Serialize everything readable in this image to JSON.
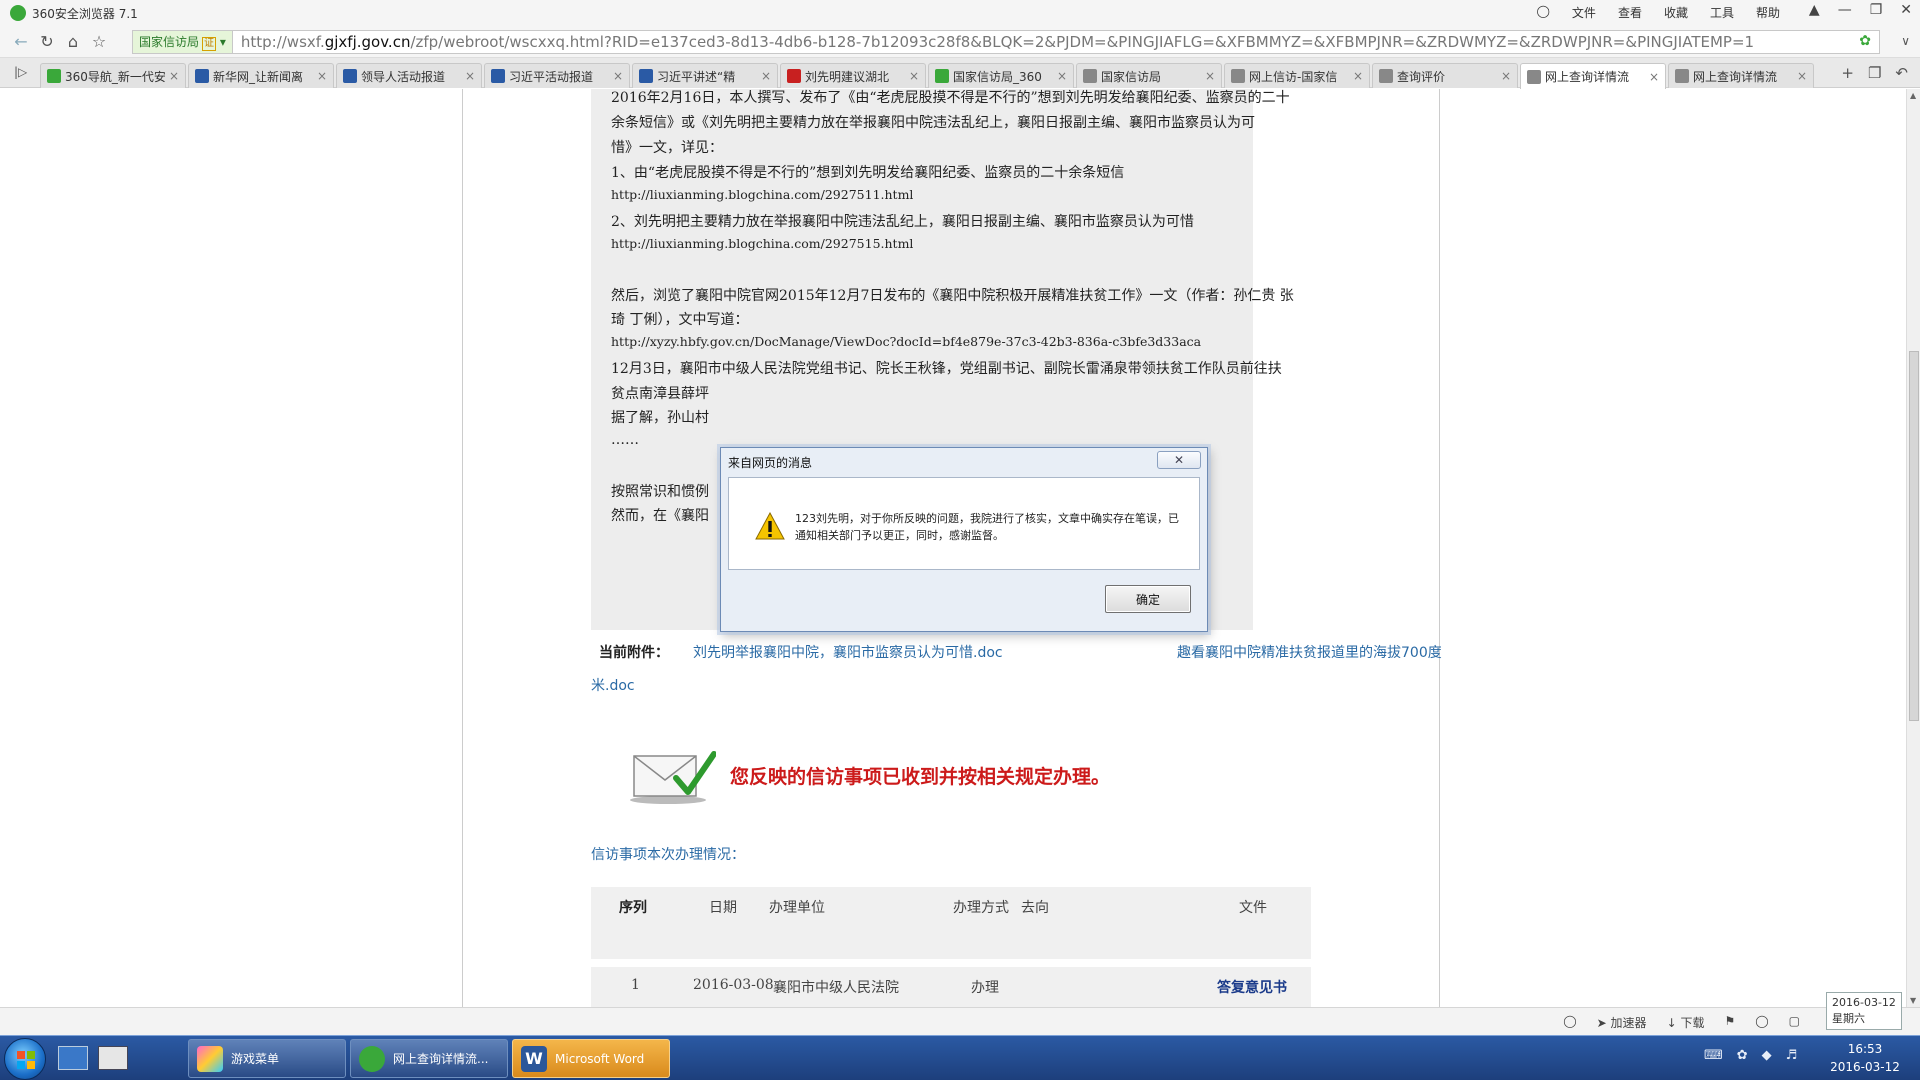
{
  "window": {
    "title": "360安全浏览器 7.1",
    "menus": [
      "文件",
      "查看",
      "收藏",
      "工具",
      "帮助"
    ]
  },
  "addressbar": {
    "site_id": "国家信访局",
    "cert_badge": "证",
    "url_prefix": "http://wsxf.",
    "url_domain": "gjxfj.gov.cn",
    "url_rest": "/zfp/webroot/wscxxq.html?RID=e137ced3-8d13-4db6-b128-7b12093c28f8&BLQK=2&PJDM=&PINGJIAFLG=&XFBMMYZ=&XFBMPJNR=&ZRDWMYZ=&ZRDWPJNR=&PINGJIATEMP=1"
  },
  "tabs": [
    {
      "label": "360导航_新一代安",
      "icon_color": "#3aa83a"
    },
    {
      "label": "新华网_让新闻离",
      "icon_color": "#2a5aa5"
    },
    {
      "label": "领导人活动报道",
      "icon_color": "#2a5aa5"
    },
    {
      "label": "习近平活动报道",
      "icon_color": "#2a5aa5"
    },
    {
      "label": "习近平讲述“精",
      "icon_color": "#2a5aa5"
    },
    {
      "label": "刘先明建议湖北",
      "icon_color": "#c82020"
    },
    {
      "label": "国家信访局_360",
      "icon_color": "#3aa83a"
    },
    {
      "label": "国家信访局",
      "icon_color": "#888888"
    },
    {
      "label": "网上信访-国家信",
      "icon_color": "#888888"
    },
    {
      "label": "查询评价",
      "icon_color": "#888888"
    },
    {
      "label": "网上查询详情流",
      "icon_color": "#888888"
    },
    {
      "label": "网上查询详情流",
      "icon_color": "#888888"
    }
  ],
  "letter": {
    "lines": [
      "2016年2月16日，本人撰写、发布了《由“老虎屁股摸不得是不行的”想到刘先明发给襄阳纪委、监察员的二十",
      "余条短信》或《刘先明把主要精力放在举报襄阳中院违法乱纪上，襄阳日报副主编、襄阳市监察员认为可",
      "惜》一文，详见：",
      "1、由“老虎屁股摸不得是不行的”想到刘先明发给襄阳纪委、监察员的二十余条短信",
      "http://liuxianming.blogchina.com/2927511.html",
      "2、刘先明把主要精力放在举报襄阳中院违法乱纪上，襄阳日报副主编、襄阳市监察员认为可惜",
      "http://liuxianming.blogchina.com/2927515.html",
      "然后，浏览了襄阳中院官网2015年12月7日发布的《襄阳中院积极开展精准扶贫工作》一文（作者：孙仁贵 张",
      "琦 丁俐），文中写道：",
      "http://xyzy.hbfy.gov.cn/DocManage/ViewDoc?docId=bf4e879e-37c3-42b3-836a-c3bfe3d33aca",
      "12月3日，襄阳市中级人民法院党组书记、院长王秋锋，党组副书记、副院长雷涌泉带领扶贫工作队员前往扶",
      "贫点南漳县薛坪",
      "据了解，孙山村",
      "……",
      "按照常识和惯例",
      "然而，在《襄阳"
    ]
  },
  "attachments": {
    "label": "当前附件：",
    "file1": "刘先明举报襄阳中院，襄阳市监察员认为可惜.doc",
    "file2_part1": "趣看襄阳中院精准扶贫报道里的海拔700度",
    "file2_part2": "米.doc"
  },
  "received_message": "您反映的信访事项已收到并按相关规定办理。",
  "status_section": {
    "title": "信访事项本次办理情况：",
    "headers": {
      "seq": "序列",
      "date": "日期",
      "unit": "办理单位",
      "method": "办理方式",
      "direction": "去向",
      "file": "文件"
    },
    "rows": [
      {
        "seq": "1",
        "date": "2016-03-08",
        "unit": "襄阳市中级人民法院",
        "method": "办理",
        "file": "答复意见书"
      }
    ]
  },
  "dialog": {
    "title": "来自网页的消息",
    "message": "123刘先明，对于你所反映的问题，我院进行了核实，文章中确实存在笔误，已通知相关部门予以更正，同时，感谢监督。",
    "ok_label": "确定"
  },
  "statusbar": {
    "items": [
      "加速器",
      "下载"
    ],
    "date_popup": {
      "date": "2016-03-12",
      "weekday": "星期六"
    }
  },
  "taskbar": {
    "buttons": [
      {
        "label": "游戏菜单",
        "active": false
      },
      {
        "label": "网上查询详情流...",
        "active": false
      },
      {
        "label": "Microsoft Word",
        "active": true
      }
    ],
    "clock_time": "16:53",
    "clock_date": "2016-03-12"
  }
}
